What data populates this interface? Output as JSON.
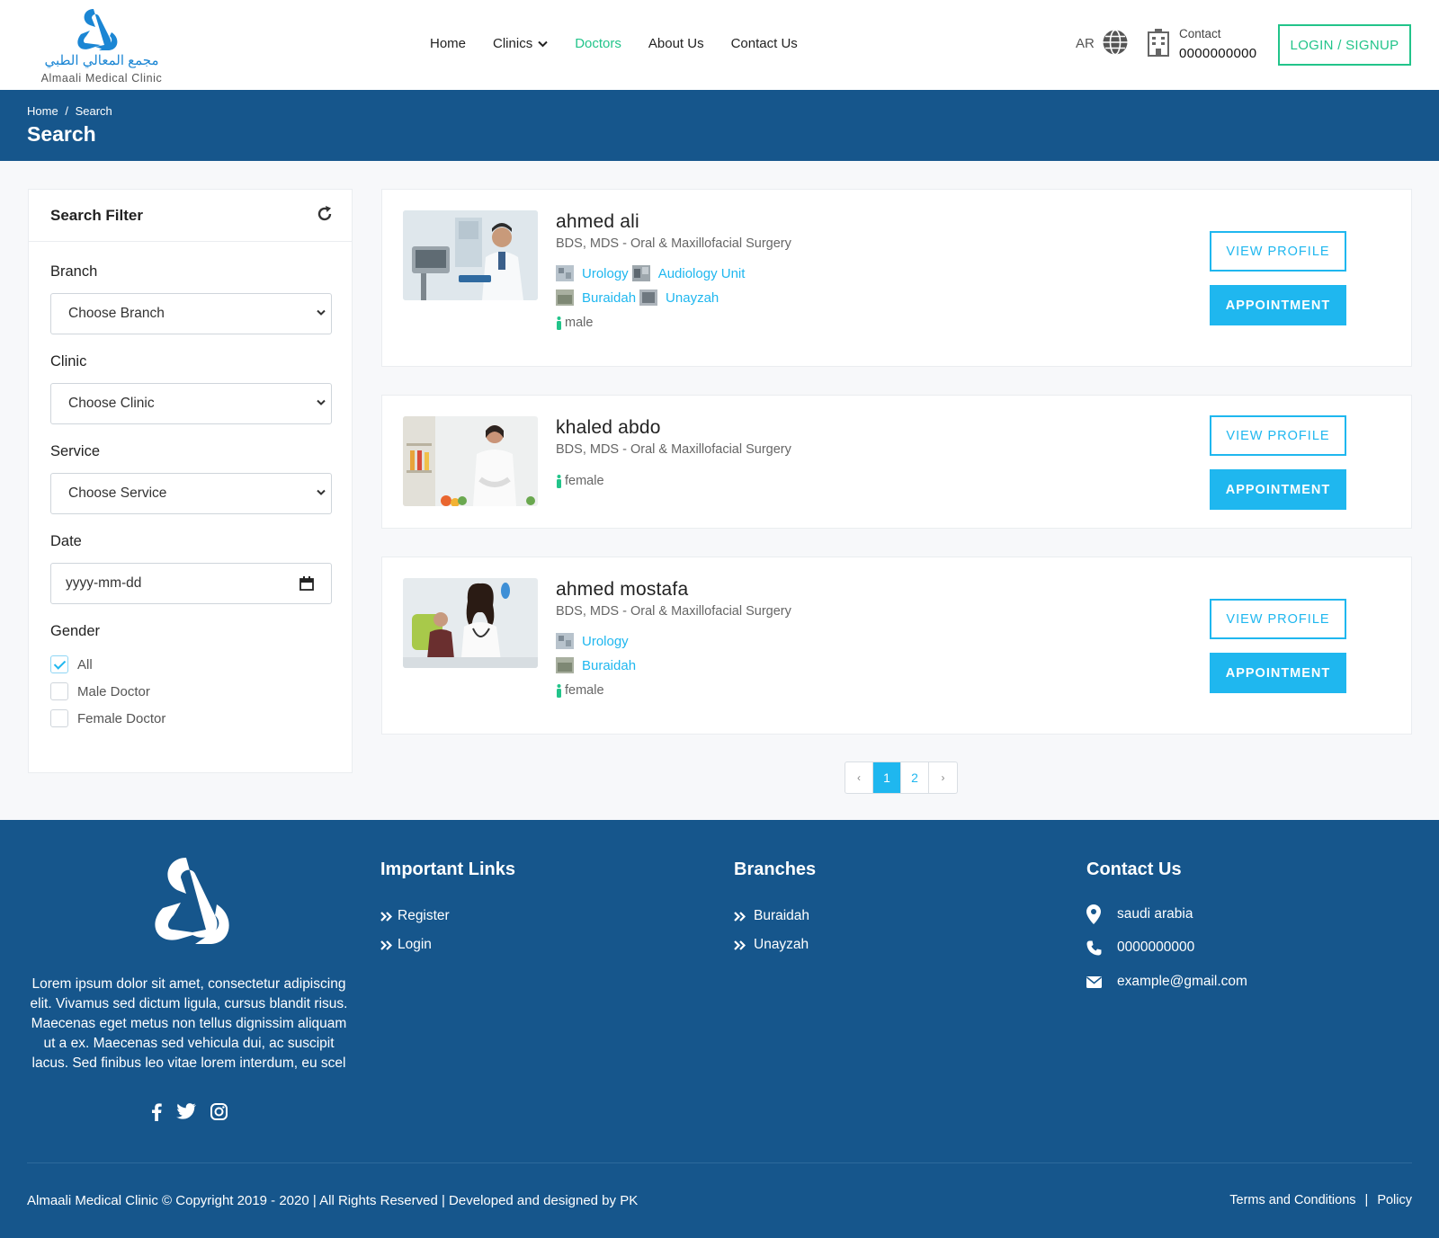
{
  "header": {
    "logo_arabic": "مجمع المعالي الطبي",
    "logo_english": "Almaali Medical Clinic",
    "nav": [
      {
        "label": "Home"
      },
      {
        "label": "Clinics"
      },
      {
        "label": "Doctors"
      },
      {
        "label": "About Us"
      },
      {
        "label": "Contact Us"
      }
    ],
    "language": "AR",
    "contact_label": "Contact",
    "contact_number": "0000000000",
    "login_label": "LOGIN / SIGNUP"
  },
  "banner": {
    "breadcrumb": [
      "Home",
      "/",
      "Search"
    ],
    "title": "Search"
  },
  "filter": {
    "title": "Search Filter",
    "branch_label": "Branch",
    "branch_value": "Choose Branch",
    "clinic_label": "Clinic",
    "clinic_value": "Choose Clinic",
    "service_label": "Service",
    "service_value": "Choose Service",
    "date_label": "Date",
    "date_placeholder": "yyyy-mm-dd",
    "gender_label": "Gender",
    "gender_options": [
      {
        "label": "All",
        "checked": true
      },
      {
        "label": "Male Doctor",
        "checked": false
      },
      {
        "label": "Female Doctor",
        "checked": false
      }
    ]
  },
  "doctors": [
    {
      "name": "ahmed ali",
      "title": "BDS, MDS - Oral & Maxillofacial Surgery",
      "clinics": [
        "Urology",
        "Audiology Unit"
      ],
      "branches": [
        "Buraidah",
        "Unayzah"
      ],
      "gender": "male"
    },
    {
      "name": "khaled abdo",
      "title": "BDS, MDS - Oral & Maxillofacial Surgery",
      "clinics": [],
      "branches": [],
      "gender": "female"
    },
    {
      "name": "ahmed mostafa",
      "title": "BDS, MDS - Oral & Maxillofacial Surgery",
      "clinics": [
        "Urology"
      ],
      "branches": [
        "Buraidah"
      ],
      "gender": "female"
    }
  ],
  "buttons": {
    "view_profile": "VIEW PROFILE",
    "appointment": "APPOINTMENT"
  },
  "pagination": {
    "prev": "‹",
    "pages": [
      "1",
      "2"
    ],
    "current": "1",
    "next": "›"
  },
  "footer": {
    "about": "Lorem ipsum dolor sit amet, consectetur adipiscing elit. Vivamus sed dictum ligula, cursus blandit risus. Maecenas eget metus non tellus dignissim aliquam ut a ex. Maecenas sed vehicula dui, ac suscipit lacus. Sed finibus leo vitae lorem interdum, eu scel",
    "links_title": "Important Links",
    "links": [
      "Register",
      "Login"
    ],
    "branches_title": "Branches",
    "branches": [
      "Buraidah",
      "Unayzah"
    ],
    "contact_title": "Contact Us",
    "address": "saudi arabia",
    "phone": "0000000000",
    "email": "example@gmail.com",
    "copyright": "Almaali Medical Clinic © Copyright 2019 - 2020 | All Rights Reserved | Developed and designed by PK",
    "terms": "Terms and Conditions",
    "legal_sep": "|",
    "policy": "Policy"
  },
  "colors": {
    "primary_blue": "#16568c",
    "accent_cyan": "#1fb7ef",
    "accent_green": "#22c48a"
  },
  "icons": [
    "logo-mark",
    "chevron-down-icon",
    "globe-icon",
    "building-icon",
    "refresh-icon",
    "calendar-icon",
    "clinic-thumb-icon",
    "branch-thumb-icon",
    "person-icon",
    "double-chevron-icon",
    "location-icon",
    "phone-icon",
    "mail-icon",
    "facebook-icon",
    "twitter-icon",
    "instagram-icon"
  ]
}
